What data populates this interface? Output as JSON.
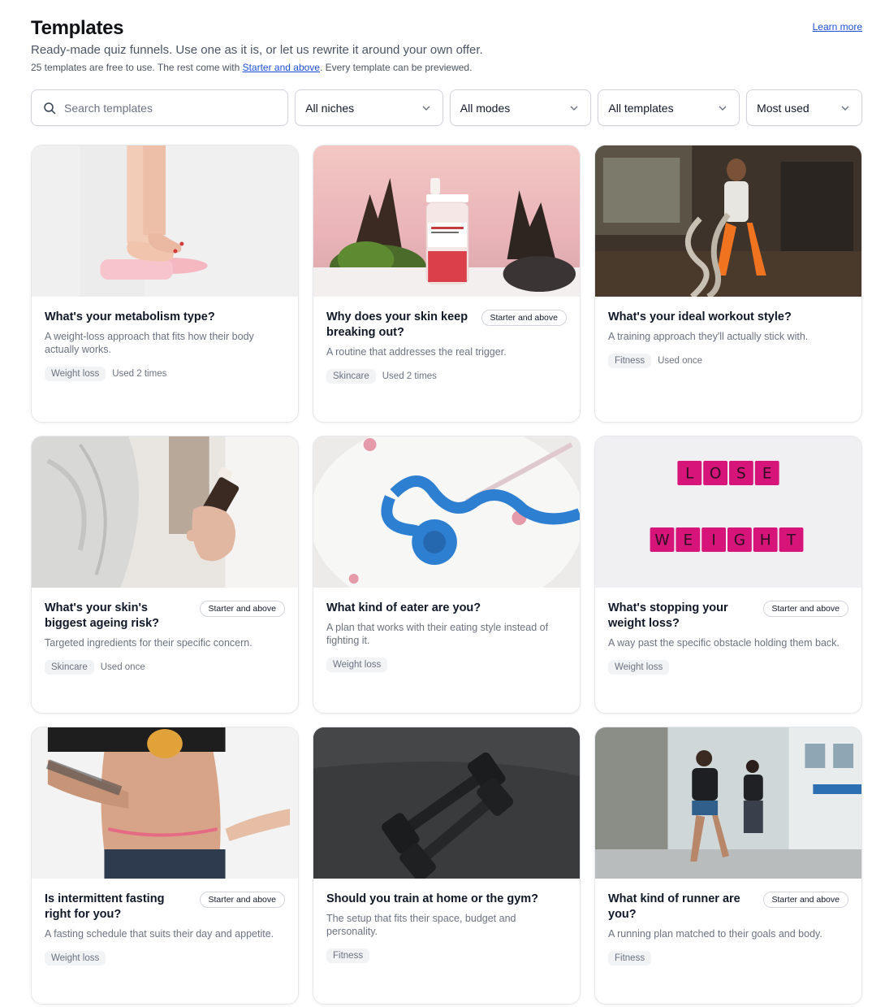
{
  "header": {
    "title": "Templates",
    "subtitle": "Ready-made quiz funnels. Use one as it is, or let us rewrite it around your own offer.",
    "note_prefix": "25 templates are free to use. The rest come with ",
    "note_link": "Starter and above",
    "note_suffix": ". Every template can be previewed.",
    "learn_more": "Learn more"
  },
  "filters": {
    "search_placeholder": "Search templates",
    "niches": "All niches",
    "modes": "All modes",
    "templates": "All templates",
    "sort": "Most used"
  },
  "cards": [
    {
      "title": "What's your metabolism type?",
      "badge": "",
      "desc": "A weight-loss approach that fits how their body actually works.",
      "tag": "Weight loss",
      "usage": "Used 2 times",
      "image": "feet-on-scale"
    },
    {
      "title": "Why does your skin keep breaking out?",
      "badge": "Starter and above",
      "desc": "A routine that addresses the real trigger.",
      "tag": "Skincare",
      "usage": "Used 2 times",
      "image": "serum-bottle"
    },
    {
      "title": "What's your ideal workout style?",
      "badge": "",
      "desc": "A training approach they'll actually stick with.",
      "tag": "Fitness",
      "usage": "Used once",
      "image": "battle-ropes"
    },
    {
      "title": "What's your skin's biggest ageing risk?",
      "badge": "Starter and above",
      "desc": "Targeted ingredients for their specific concern.",
      "tag": "Skincare",
      "usage": "Used once",
      "image": "hand-bottle"
    },
    {
      "title": "What kind of eater are you?",
      "badge": "",
      "desc": "A plan that works with their eating style instead of fighting it.",
      "tag": "Weight loss",
      "usage": "",
      "image": "tape-plate"
    },
    {
      "title": "What's stopping your weight loss?",
      "badge": "Starter and above",
      "desc": "A way past the specific obstacle holding them back.",
      "tag": "Weight loss",
      "usage": "",
      "image": "lose-weight-tiles"
    },
    {
      "title": "Is intermittent fasting right for you?",
      "badge": "Starter and above",
      "desc": "A fasting schedule that suits their day and appetite.",
      "tag": "Weight loss",
      "usage": "",
      "image": "waist-measure"
    },
    {
      "title": "Should you train at home or the gym?",
      "badge": "",
      "desc": "The setup that fits their space, budget and personality.",
      "tag": "Fitness",
      "usage": "",
      "image": "dumbbells"
    },
    {
      "title": "What kind of runner are you?",
      "badge": "Starter and above",
      "desc": "A running plan matched to their goals and body.",
      "tag": "Fitness",
      "usage": "",
      "image": "runners"
    }
  ],
  "tiles": {
    "row1": [
      "L",
      "O",
      "S",
      "E"
    ],
    "row2": [
      "W",
      "E",
      "I",
      "G",
      "H",
      "T"
    ]
  }
}
